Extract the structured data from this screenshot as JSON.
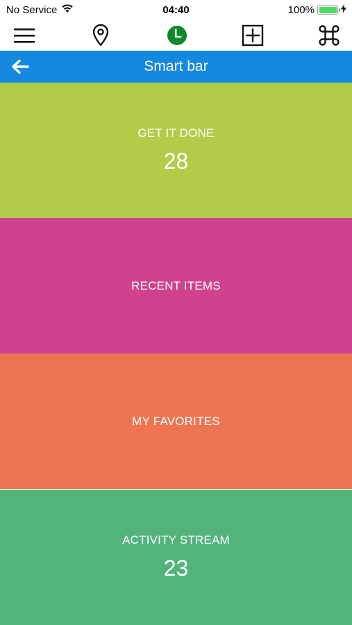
{
  "status": {
    "carrier": "No Service",
    "time": "04:40",
    "battery": "100%"
  },
  "toolbar": {
    "items": [
      {
        "icon": "menu-icon"
      },
      {
        "icon": "location-pin-icon"
      },
      {
        "icon": "clock-icon"
      },
      {
        "icon": "add-box-icon"
      },
      {
        "icon": "command-icon"
      }
    ]
  },
  "nav": {
    "title": "Smart bar",
    "back_icon": "arrow-left-icon"
  },
  "tiles": [
    {
      "label": "GET IT DONE",
      "count": "28",
      "color": "#b0cc48"
    },
    {
      "label": "RECENT ITEMS",
      "count": "",
      "color": "#d0428e"
    },
    {
      "label": "MY FAVORITES",
      "count": "",
      "color": "#ee7552"
    },
    {
      "label": "ACTIVITY STREAM",
      "count": "23",
      "color": "#52b47b"
    }
  ],
  "colors": {
    "nav_bar": "#1589e0",
    "clock_icon": "#0e8a2a",
    "battery_fill": "#4cd964"
  }
}
